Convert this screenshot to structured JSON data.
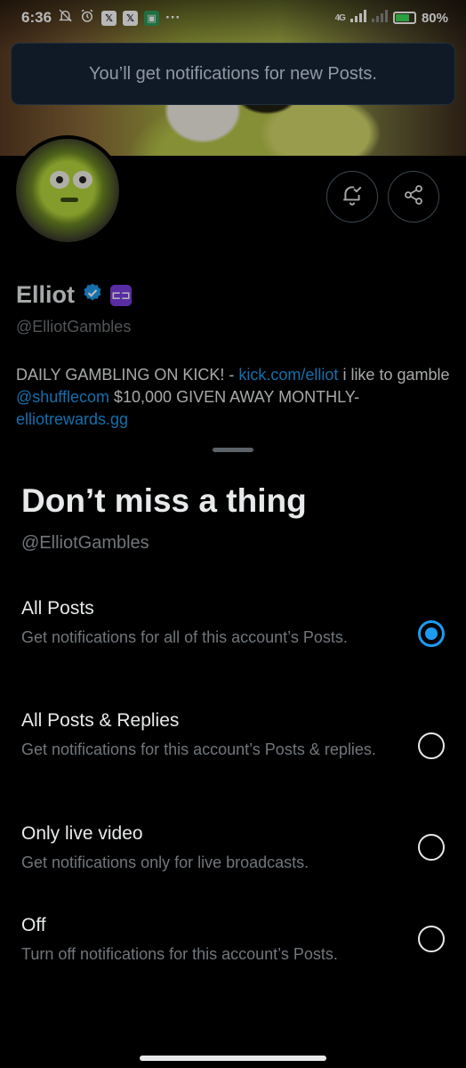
{
  "status_bar": {
    "time": "6:36",
    "dots": "···",
    "network": "4G",
    "battery": "80%"
  },
  "toast": {
    "message": "You’ll get notifications for new Posts."
  },
  "profile": {
    "name": "Elliot",
    "handle": "@ElliotGambles",
    "bio": {
      "text1": "DAILY GAMBLING ON KICK! - ",
      "link1": "kick.com/elliot",
      "text2": " i like to gamble ",
      "link2": "@shufflecom",
      "text3": " $10,000 GIVEN AWAY MONTHLY- ",
      "link3": "elliotrewards.gg"
    }
  },
  "sheet": {
    "title": "Don’t miss a thing",
    "handle": "@ElliotGambles",
    "options": [
      {
        "title": "All Posts",
        "desc": "Get notifications for all of this account’s Posts.",
        "selected": true
      },
      {
        "title": "All Posts & Replies",
        "desc": "Get notifications for this account’s Posts & replies.",
        "selected": false
      },
      {
        "title": "Only live video",
        "desc": "Get notifications only for live broadcasts.",
        "selected": false
      },
      {
        "title": "Off",
        "desc": "Turn off notifications for this account’s Posts.",
        "selected": false
      }
    ]
  },
  "colors": {
    "accent": "#1d9bf0",
    "background": "#000000",
    "secondary_text": "#71767b",
    "toast_bg": "#172436",
    "kick_badge": "#7b3fe4"
  }
}
